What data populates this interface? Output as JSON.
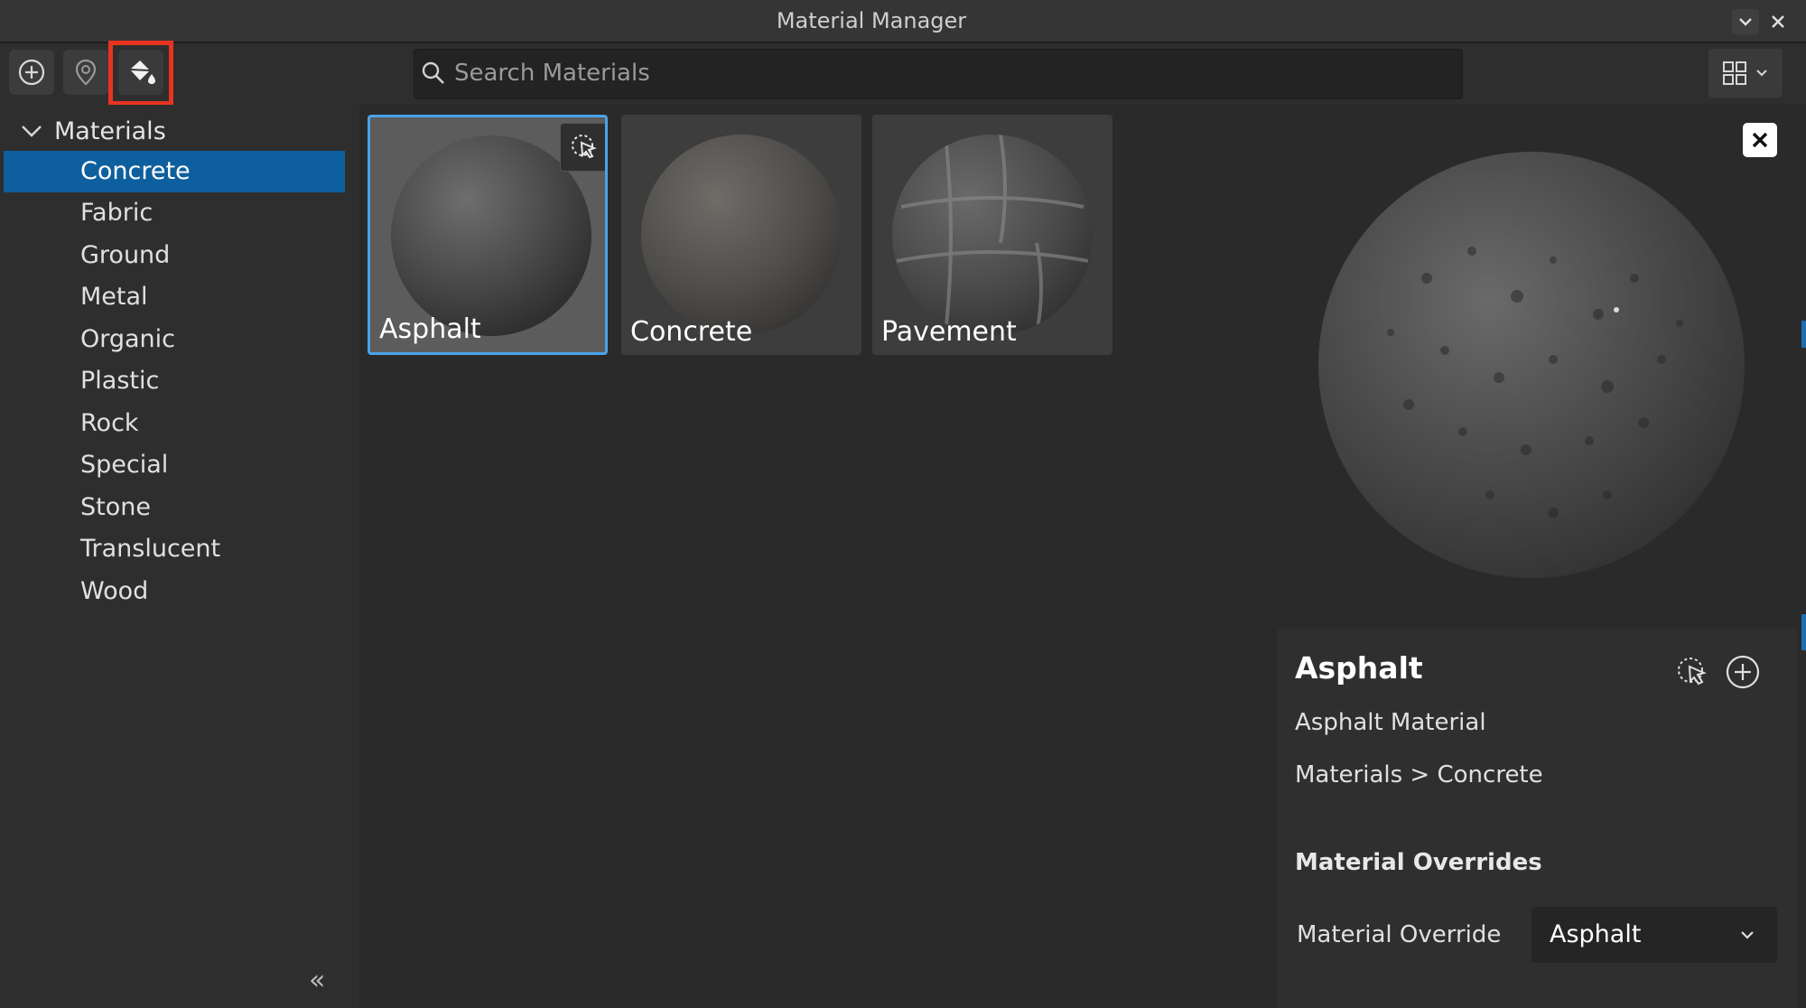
{
  "window": {
    "title": "Material Manager",
    "controls": [
      {
        "name": "minimize",
        "icon": "chevron-down-icon"
      },
      {
        "name": "close",
        "icon": "close-icon"
      }
    ]
  },
  "toolbar": {
    "buttons": [
      {
        "name": "create-material",
        "icon": "plus-circle-icon"
      },
      {
        "name": "show-in-explorer",
        "icon": "location-pin-icon"
      },
      {
        "name": "apply-material",
        "icon": "paint-bucket-icon",
        "highlighted": true
      }
    ],
    "search": {
      "placeholder": "Search Materials",
      "value": ""
    },
    "view_toggle": {
      "icon": "grid-view-icon"
    }
  },
  "sidebar": {
    "root_label": "Materials",
    "items": [
      {
        "label": "Concrete",
        "selected": true
      },
      {
        "label": "Fabric"
      },
      {
        "label": "Ground"
      },
      {
        "label": "Metal"
      },
      {
        "label": "Organic"
      },
      {
        "label": "Plastic"
      },
      {
        "label": "Rock"
      },
      {
        "label": "Special"
      },
      {
        "label": "Stone"
      },
      {
        "label": "Translucent"
      },
      {
        "label": "Wood"
      }
    ],
    "collapse_label": "«"
  },
  "grid": {
    "tiles": [
      {
        "label": "Asphalt",
        "selected": true
      },
      {
        "label": "Concrete"
      },
      {
        "label": "Pavement"
      }
    ]
  },
  "details": {
    "title": "Asphalt",
    "subtitle": "Asphalt Material",
    "path": "Materials > Concrete",
    "section_title": "Material Overrides",
    "override_label": "Material Override",
    "override_value": "Asphalt"
  },
  "colors": {
    "accent": "#0e5f9e",
    "selection_border": "#4aa3e8",
    "highlight_box": "#e8341f"
  }
}
